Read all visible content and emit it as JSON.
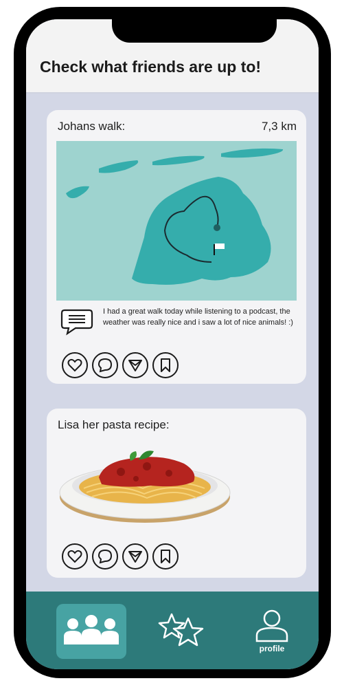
{
  "header": {
    "title": "Check what friends are up to!"
  },
  "posts": [
    {
      "title": "Johans walk:",
      "distance": "7,3 km",
      "comment": "I had a great walk today while listening to a podcast, the weather was really nice and i saw a lot of nice animals! :)",
      "actions": [
        "heart-icon",
        "chat-bubble-icon",
        "send-icon",
        "bookmark-icon"
      ]
    },
    {
      "title": "Lisa her pasta recipe:",
      "actions": [
        "heart-icon",
        "chat-bubble-icon",
        "send-icon",
        "bookmark-icon"
      ]
    }
  ],
  "nav": {
    "items": [
      {
        "icon": "friends-group-icon",
        "active": true
      },
      {
        "icon": "stars-icon",
        "active": false
      },
      {
        "icon": "profile-icon",
        "label": "profile",
        "active": false
      }
    ]
  },
  "colors": {
    "map_water": "#9ed3cf",
    "map_land": "#35adac",
    "nav_bg": "#2d7a7a",
    "nav_active": "#47a3a3",
    "background": "#d3d7e6"
  }
}
